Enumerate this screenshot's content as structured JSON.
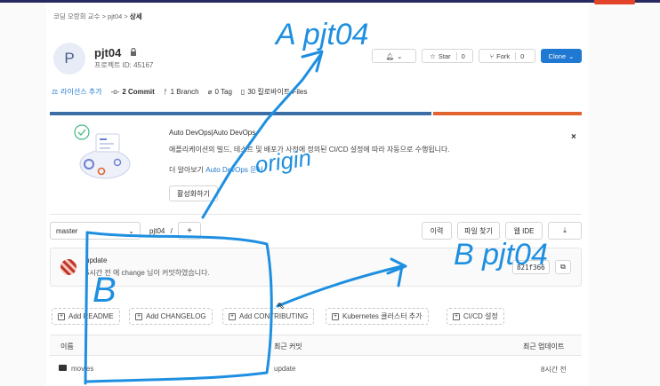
{
  "breadcrumb": {
    "group": "코딩 오랑회 교수",
    "sep1": ">",
    "project": "pjt04",
    "sep2": ">",
    "current": "상세"
  },
  "project": {
    "avatar_letter": "P",
    "name": "pjt04",
    "id_label": "프로젝트 ID: 45167"
  },
  "header_buttons": {
    "notify": "",
    "star_label": "Star",
    "star_count": "0",
    "fork_label": "Fork",
    "fork_count": "0",
    "clone_label": "Clone"
  },
  "stats": {
    "license": "라이선스 추가",
    "commits": "2 Commit",
    "branches": "1 Branch",
    "tags": "0 Tag",
    "files": "30 킬로바이트 Files"
  },
  "language_bar": {
    "segments": [
      {
        "share": 0.72,
        "color": "#3a6ea5"
      },
      {
        "share": 0.28,
        "color": "#e1632f"
      }
    ]
  },
  "promo": {
    "title": "Auto DevOps|Auto DevOps",
    "text": "애플리케이션의 빌드, 테스트 및 배포가 사전에 정의된 CI/CD 설정에 따라 자동으로 수행됩니다.",
    "link_prefix": "더 알아보기",
    "link_text": "Auto DevOps 문서",
    "button": "활성화하기",
    "close": "×"
  },
  "repo": {
    "branch": "master",
    "path": "pjt04",
    "path_sep": "/",
    "add": "+",
    "history": "이력",
    "find_file": "파일 찾기",
    "web_ide": "웹 IDE",
    "download": ""
  },
  "commit": {
    "title": "update",
    "meta": "5시간 전 에 change 님이 커밋하였습니다.",
    "sha": "821f366",
    "copy": ""
  },
  "quick_add": [
    "Add README",
    "Add CHANGELOG",
    "Add CONTRIBUTING",
    "Kubernetes 클러스터 추가",
    "CI/CD 설정"
  ],
  "table": {
    "headers": {
      "name": "이름",
      "last_commit": "최근 커밋",
      "last_update": "최근 업데이트"
    },
    "rows": [
      {
        "name": "movies",
        "commit": "update",
        "updated": "8시간 전"
      }
    ]
  },
  "annotations": {
    "a_label": "A pjt04",
    "origin_label": "origin",
    "b_label": "B",
    "b_right_label": "B pjt04",
    "color": "#1e8fe0"
  }
}
